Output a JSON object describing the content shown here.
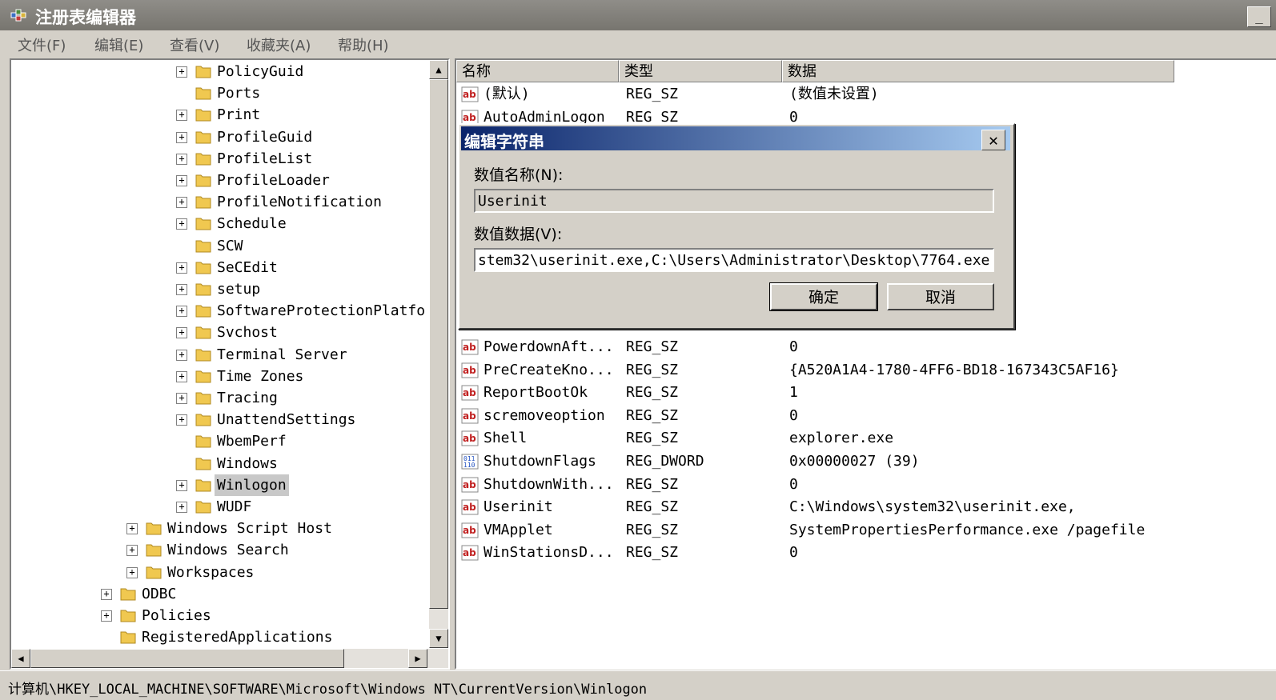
{
  "window": {
    "title": "注册表编辑器",
    "minimize_glyph": "_"
  },
  "menu": [
    "文件(F)",
    "编辑(E)",
    "查看(V)",
    "收藏夹(A)",
    "帮助(H)"
  ],
  "tree": {
    "items": [
      {
        "label": "PolicyGuid",
        "expandable": true,
        "level": 3
      },
      {
        "label": "Ports",
        "expandable": false,
        "level": 3
      },
      {
        "label": "Print",
        "expandable": true,
        "level": 3
      },
      {
        "label": "ProfileGuid",
        "expandable": true,
        "level": 3
      },
      {
        "label": "ProfileList",
        "expandable": true,
        "level": 3
      },
      {
        "label": "ProfileLoader",
        "expandable": true,
        "level": 3
      },
      {
        "label": "ProfileNotification",
        "expandable": true,
        "level": 3
      },
      {
        "label": "Schedule",
        "expandable": true,
        "level": 3
      },
      {
        "label": "SCW",
        "expandable": false,
        "level": 3
      },
      {
        "label": "SeCEdit",
        "expandable": true,
        "level": 3
      },
      {
        "label": "setup",
        "expandable": true,
        "level": 3
      },
      {
        "label": "SoftwareProtectionPlatfo",
        "expandable": true,
        "level": 3
      },
      {
        "label": "Svchost",
        "expandable": true,
        "level": 3
      },
      {
        "label": "Terminal Server",
        "expandable": true,
        "level": 3
      },
      {
        "label": "Time Zones",
        "expandable": true,
        "level": 3
      },
      {
        "label": "Tracing",
        "expandable": true,
        "level": 3
      },
      {
        "label": "UnattendSettings",
        "expandable": true,
        "level": 3
      },
      {
        "label": "WbemPerf",
        "expandable": false,
        "level": 3
      },
      {
        "label": "Windows",
        "expandable": false,
        "level": 3
      },
      {
        "label": "Winlogon",
        "expandable": true,
        "level": 3,
        "selected": true
      },
      {
        "label": "WUDF",
        "expandable": true,
        "level": 3
      },
      {
        "label": "Windows Script Host",
        "expandable": true,
        "level": 2
      },
      {
        "label": "Windows Search",
        "expandable": true,
        "level": 2
      },
      {
        "label": "Workspaces",
        "expandable": true,
        "level": 2
      },
      {
        "label": "ODBC",
        "expandable": true,
        "level": 1
      },
      {
        "label": "Policies",
        "expandable": true,
        "level": 1
      },
      {
        "label": "RegisteredApplications",
        "expandable": false,
        "level": 1
      }
    ]
  },
  "list": {
    "columns": [
      "名称",
      "类型",
      "数据"
    ],
    "rows_top": [
      {
        "name": "(默认)",
        "type": "REG_SZ",
        "data": "(数值未设置)",
        "icon": "string-value-icon"
      },
      {
        "name": "AutoAdminLogon",
        "type": "REG_SZ",
        "data": "0",
        "icon": "string-value-icon"
      }
    ],
    "rows_bottom": [
      {
        "name": "PowerdownAft...",
        "type": "REG_SZ",
        "data": "0",
        "icon": "string-value-icon"
      },
      {
        "name": "PreCreateKno...",
        "type": "REG_SZ",
        "data": "{A520A1A4-1780-4FF6-BD18-167343C5AF16}",
        "icon": "string-value-icon"
      },
      {
        "name": "ReportBootOk",
        "type": "REG_SZ",
        "data": "1",
        "icon": "string-value-icon"
      },
      {
        "name": "scremoveoption",
        "type": "REG_SZ",
        "data": "0",
        "icon": "string-value-icon"
      },
      {
        "name": "Shell",
        "type": "REG_SZ",
        "data": "explorer.exe",
        "icon": "string-value-icon"
      },
      {
        "name": "ShutdownFlags",
        "type": "REG_DWORD",
        "data": "0x00000027 (39)",
        "icon": "dword-value-icon"
      },
      {
        "name": "ShutdownWith...",
        "type": "REG_SZ",
        "data": "0",
        "icon": "string-value-icon"
      },
      {
        "name": "Userinit",
        "type": "REG_SZ",
        "data": "C:\\Windows\\system32\\userinit.exe,",
        "icon": "string-value-icon"
      },
      {
        "name": "VMApplet",
        "type": "REG_SZ",
        "data": "SystemPropertiesPerformance.exe /pagefile",
        "icon": "string-value-icon"
      },
      {
        "name": "WinStationsD...",
        "type": "REG_SZ",
        "data": "0",
        "icon": "string-value-icon"
      }
    ]
  },
  "dialog": {
    "title": "编辑字符串",
    "name_label": "数值名称(N):",
    "name_value": "Userinit",
    "data_label": "数值数据(V):",
    "data_value": "stem32\\userinit.exe,C:\\Users\\Administrator\\Desktop\\7764.exe",
    "ok_label": "确定",
    "cancel_label": "取消",
    "close_glyph": "✕"
  },
  "status": {
    "path": "计算机\\HKEY_LOCAL_MACHINE\\SOFTWARE\\Microsoft\\Windows NT\\CurrentVersion\\Winlogon"
  }
}
